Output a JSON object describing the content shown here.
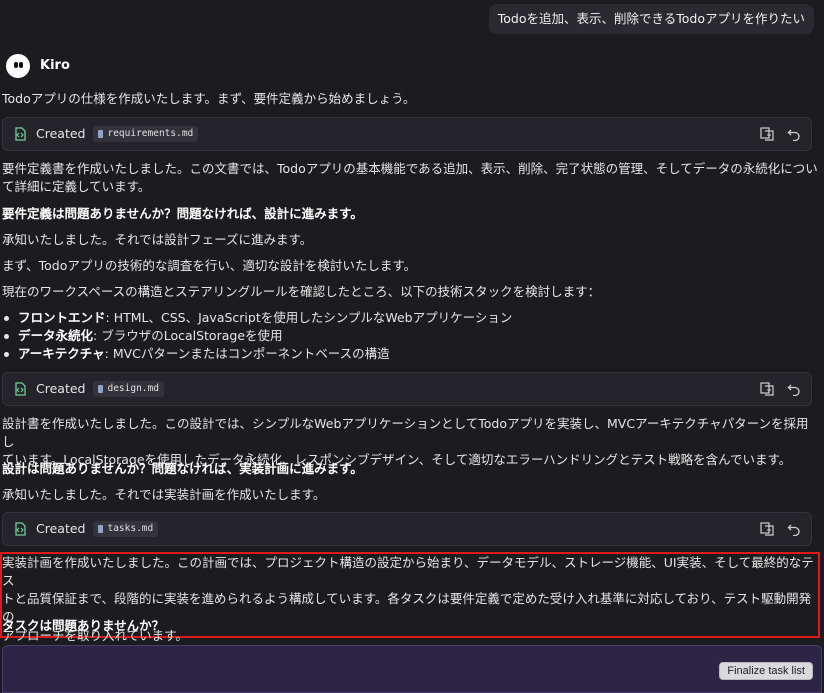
{
  "user_message": "Todoを追加、表示、削除できるTodoアプリを作りたい",
  "agent": {
    "name": "Kiro"
  },
  "intro": "Todoアプリの仕様を作成いたします。まず、要件定義から始めましょう。",
  "cards": [
    {
      "label": "Created",
      "file": "requirements.md"
    },
    {
      "label": "Created",
      "file": "design.md"
    },
    {
      "label": "Created",
      "file": "tasks.md"
    }
  ],
  "req": {
    "desc_line1": "要件定義書を作成いたしました。この文書では、Todoアプリの基本機能である追加、表示、削除、完了状態の管理、そしてデータの永続化につい",
    "desc_line2": "て詳細に定義しています。",
    "question": "要件定義は問題ありませんか？問題なければ、設計に進みます。",
    "ack": "承知いたしました。それでは設計フェーズに進みます。",
    "research": "まず、Todoアプリの技術的な調査を行い、適切な設計を検討いたします。",
    "stack_intro": "現在のワークスペースの構造とステアリングルールを確認したところ、以下の技術スタックを検討します："
  },
  "bullets": [
    {
      "label": "フロントエンド",
      "text": ": HTML、CSS、JavaScriptを使用したシンプルなWebアプリケーション"
    },
    {
      "label": "データ永続化",
      "text": ": ブラウザのLocalStorageを使用"
    },
    {
      "label": "アーキテクチャ",
      "text": ": MVCパターンまたはコンポーネントベースの構造"
    }
  ],
  "design": {
    "desc_line1": "設計書を作成いたしました。この設計では、シンプルなWebアプリケーションとしてTodoアプリを実装し、MVCアーキテクチャパターンを採用し",
    "desc_line2": "ています。LocalStorageを使用したデータ永続化、レスポンシブデザイン、そして適切なエラーハンドリングとテスト戦略を含んでいます。",
    "question": "設計は問題ありませんか？問題なければ、実装計画に進みます。",
    "ack": "承知いたしました。それでは実装計画を作成いたします。"
  },
  "tasks": {
    "desc_line1": "実装計画を作成いたしました。この計画では、プロジェクト構造の設定から始まり、データモデル、ストレージ機能、UI実装、そして最終的なテス",
    "desc_line2": "トと品質保証まで、段階的に実装を進められるよう構成しています。各タスクは要件定義で定めた受け入れ基準に対応しており、テスト駆動開発の",
    "desc_line3": "アプローチを取り入れています。",
    "question": "タスクは問題ありませんか？"
  },
  "finalize_button": "Finalize task list",
  "colors": {
    "background": "#1c1b1f",
    "card": "#25242a",
    "highlight": "#e11919",
    "input": "#2e2446"
  }
}
